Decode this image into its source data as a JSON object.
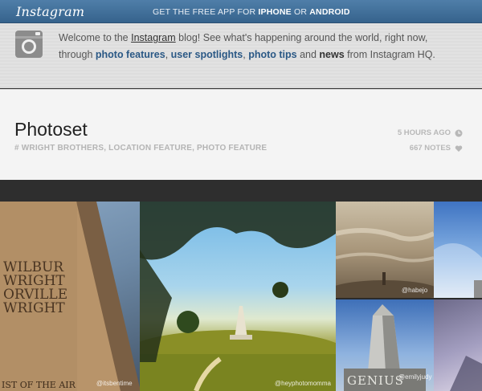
{
  "header": {
    "logo": "Instagram",
    "promo_pre": "GET THE FREE APP FOR ",
    "promo_iphone": "IPHONE",
    "promo_or": " OR ",
    "promo_android": "ANDROID"
  },
  "intro": {
    "t1": "Welcome to the ",
    "instagram_link": "Instagram",
    "t2": " blog! See what's happening around the world, right now, through ",
    "photo_features": "photo features",
    "sep1": ", ",
    "user_spotlights": "user spotlights",
    "sep2": ", ",
    "photo_tips": "photo tips",
    "t3": " and ",
    "news": "news",
    "t4": " from Instagram HQ."
  },
  "post": {
    "title": "Photoset",
    "tags_hash": "#",
    "tags": "WRIGHT BROTHERS, LOCATION FEATURE, PHOTO FEATURE",
    "time": "5 HOURS AGO",
    "notes": "667 NOTES"
  },
  "photos": {
    "monument_text": [
      "WILBUR",
      "WRIGHT",
      "ORVILLE",
      "WRIGHT"
    ],
    "monument_bottom": "IST OF THE AIR",
    "genius": "GENIUS",
    "credit1": "@itsbentime",
    "credit2": "@heyphotomomma",
    "credit3": "@habejo",
    "credit4": "@emilyjudy"
  },
  "colors": {
    "topbar": "#3e6d98",
    "link": "#2a5885",
    "meta": "#b8b8b8"
  }
}
